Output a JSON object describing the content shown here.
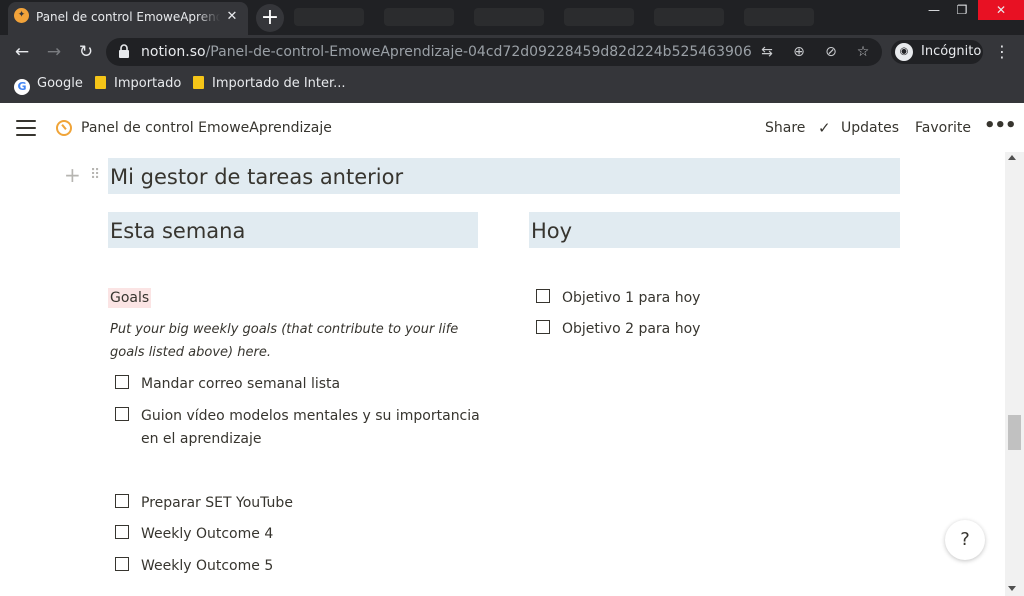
{
  "browser": {
    "tab_title": "Panel de control EmoweAprendizaje",
    "url_host": "notion.so",
    "url_path": "/Panel-de-control-EmoweAprendizaje-04cd72d09228459d82d224b525463906",
    "incognito_label": "Incógnito",
    "bookmarks": [
      "Google",
      "Importado",
      "Importado de Inter..."
    ]
  },
  "notion_topbar": {
    "breadcrumb": "Panel de control EmoweAprendizaje",
    "share": "Share",
    "updates": "Updates",
    "favorite": "Favorite"
  },
  "content": {
    "main_heading": "Mi gestor de tareas anterior",
    "week_column": {
      "heading": "Esta semana",
      "goals_label": "Goals",
      "goals_description": "Put your big weekly goals (that contribute to your life goals listed above) here.",
      "todos": [
        {
          "text": "Mandar correo semanal lista",
          "checked": false
        },
        {
          "text": "Guion vídeo modelos mentales y su importancia en el aprendizaje",
          "checked": false
        },
        {
          "text": "Preparar SET YouTube",
          "checked": false
        },
        {
          "text": "Weekly Outcome 4",
          "checked": false
        },
        {
          "text": "Weekly Outcome 5",
          "checked": false
        }
      ]
    },
    "today_column": {
      "heading": "Hoy",
      "todos": [
        {
          "text": "Objetivo 1 para hoy",
          "checked": false
        },
        {
          "text": "Objetivo 2 para hoy",
          "checked": false
        }
      ]
    }
  },
  "help_button": "?",
  "colors": {
    "heading_highlight": "#e1ebf1",
    "goals_highlight": "#fbe4e4",
    "text": "#37352f",
    "chrome_dark": "#202124",
    "chrome_toolbar": "#35363a"
  }
}
